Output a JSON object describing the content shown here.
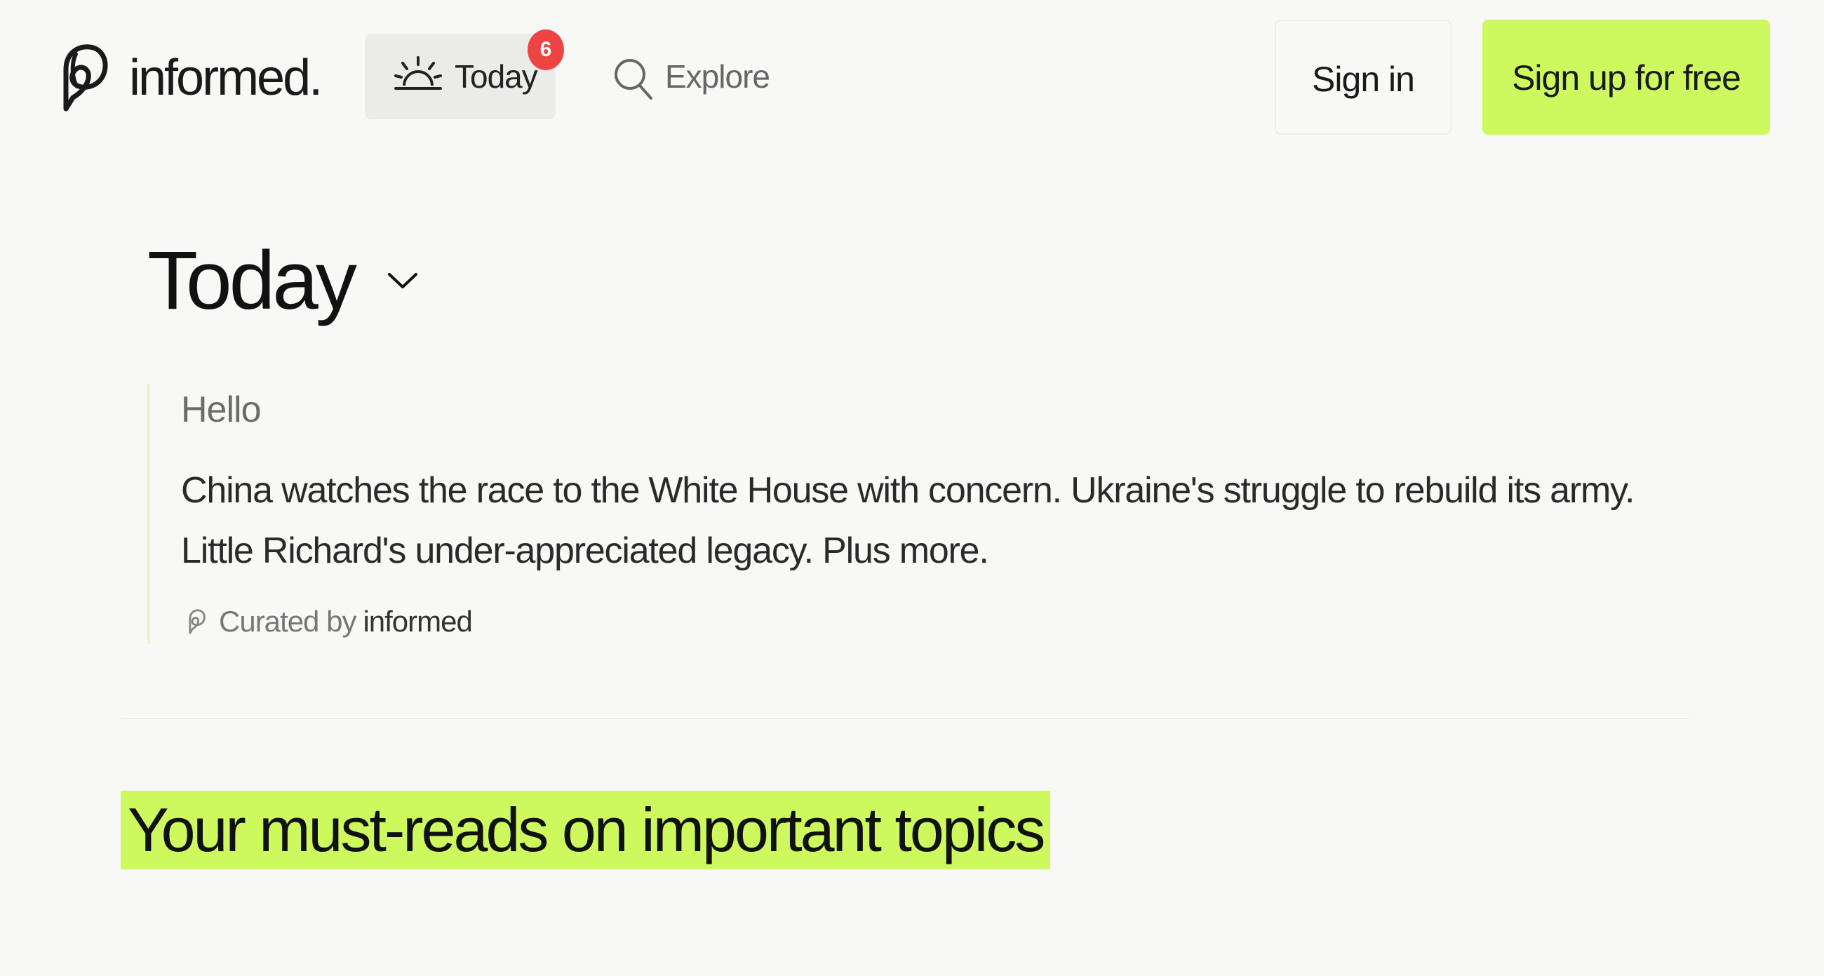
{
  "brand": {
    "name": "informed.",
    "logo_icon": "informed-logo-icon",
    "accent_color": "#cdf95f",
    "badge_color": "#ef4444"
  },
  "nav": {
    "today": {
      "label": "Today",
      "icon": "sunrise-icon",
      "badge": "6"
    },
    "explore": {
      "label": "Explore",
      "icon": "search-icon"
    }
  },
  "auth": {
    "sign_in": "Sign in",
    "sign_up": "Sign up for free"
  },
  "page": {
    "title": "Today",
    "title_icon": "chevron-down-icon"
  },
  "digest": {
    "greeting": "Hello",
    "summary": "China watches the race to the White House with concern. Ukraine's struggle to rebuild its army. Little Richard's under-appreciated legacy. Plus more.",
    "curated_prefix": "Curated by",
    "curator": "informed"
  },
  "section": {
    "heading": "Your must-reads on important topics"
  }
}
